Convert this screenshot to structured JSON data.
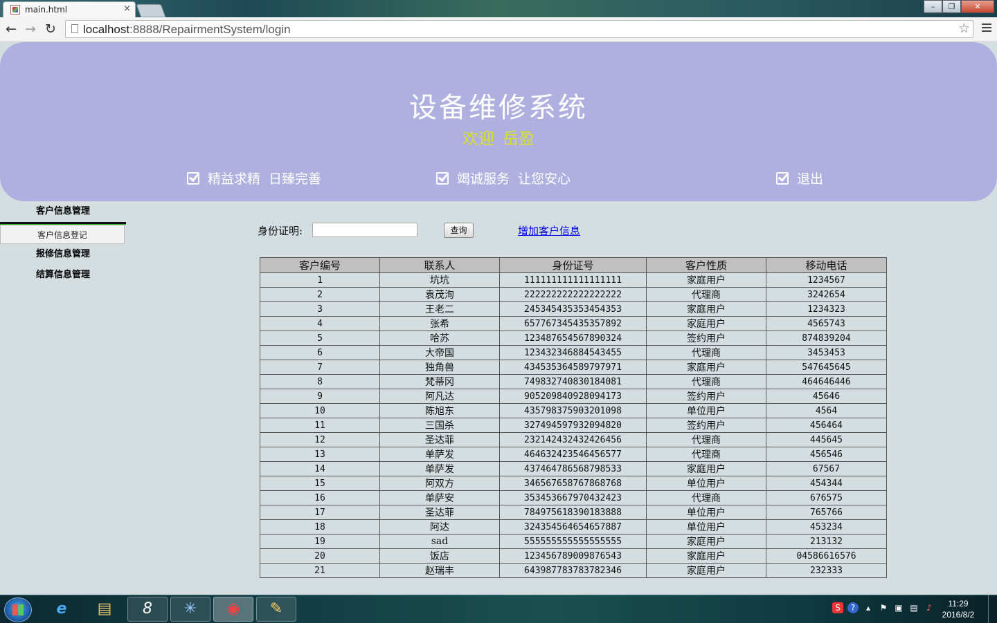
{
  "browser": {
    "tab_title": "main.html",
    "tab_close": "×",
    "url_host": "localhost",
    "url_rest": ":8888/RepairmentSystem/login",
    "window_controls": [
      "–",
      "❐",
      "✕"
    ]
  },
  "header": {
    "title": "设备维修系统",
    "welcome_word": "欢迎",
    "user_name": "岳盈",
    "slogans": [
      {
        "a": "精益求精",
        "b": "日臻完善"
      },
      {
        "a": "竭诚服务",
        "b": "让您安心"
      }
    ],
    "logout": "退出"
  },
  "sidebar": {
    "customer_mgmt": "客户信息管理",
    "customer_register": "客户信息登记",
    "repair_mgmt": "报修信息管理",
    "settlement_mgmt": "结算信息管理"
  },
  "search": {
    "label": "身份证明:",
    "value": "",
    "button": "查询",
    "add_link": "增加客户信息"
  },
  "table": {
    "headers": [
      "客户编号",
      "联系人",
      "身份证号",
      "客户性质",
      "移动电话"
    ],
    "rows": [
      [
        "1",
        "坑坑",
        "111111111111111111",
        "家庭用户",
        "1234567"
      ],
      [
        "2",
        "袁茂洵",
        "222222222222222222",
        "代理商",
        "3242654"
      ],
      [
        "3",
        "王老二",
        "245345435353454353",
        "家庭用户",
        "1234323"
      ],
      [
        "4",
        "张希",
        "657767345435357892",
        "家庭用户",
        "4565743"
      ],
      [
        "5",
        "哈苏",
        "123487654567890324",
        "签约用户",
        "874839204"
      ],
      [
        "6",
        "大帝国",
        "123432346884543455",
        "代理商",
        "3453453"
      ],
      [
        "7",
        "独角兽",
        "434535364589797971",
        "家庭用户",
        "547645645"
      ],
      [
        "8",
        "梵蒂冈",
        "749832740830184081",
        "代理商",
        "464646446"
      ],
      [
        "9",
        "阿凡达",
        "905209840928094173",
        "签约用户",
        "45646"
      ],
      [
        "10",
        "陈旭东",
        "435798375903201098",
        "单位用户",
        "4564"
      ],
      [
        "11",
        "三国杀",
        "327494597932094820",
        "签约用户",
        "456464"
      ],
      [
        "12",
        "圣达菲",
        "232142432432426456",
        "代理商",
        "445645"
      ],
      [
        "13",
        "单萨发",
        "464632423546456577",
        "代理商",
        "456546"
      ],
      [
        "14",
        "单萨发",
        "437464786568798533",
        "家庭用户",
        "67567"
      ],
      [
        "15",
        "阿双方",
        "346567658767868768",
        "单位用户",
        "454344"
      ],
      [
        "16",
        "单萨安",
        "353453667970432423",
        "代理商",
        "676575"
      ],
      [
        "17",
        "圣达菲",
        "784975618390183888",
        "单位用户",
        "765766"
      ],
      [
        "18",
        "阿达",
        "324354564654657887",
        "单位用户",
        "453234"
      ],
      [
        "19",
        "sad",
        "555555555555555555",
        "家庭用户",
        "213132"
      ],
      [
        "20",
        "饭店",
        "123456789009876543",
        "家庭用户",
        "04586616576"
      ],
      [
        "21",
        "赵瑞丰",
        "643987783783782346",
        "家庭用户",
        "232333"
      ]
    ]
  },
  "taskbar": {
    "time": "11:29",
    "date": "2016/8/2"
  },
  "colors": {
    "header_bg": "#b0b0e0",
    "welcome": "#d7e030",
    "page_bg": "#d4dde0",
    "table_header": "#c0c0c0",
    "link": "#0000ee"
  }
}
